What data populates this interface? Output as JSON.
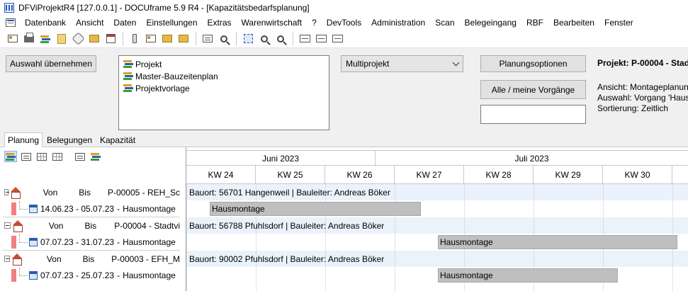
{
  "window": {
    "title": "DFViProjektR4 [127.0.0.1] - DOCUframe 5.9 R4 - [Kapazitätsbedarfsplanung]"
  },
  "menu": [
    "Datenbank",
    "Ansicht",
    "Daten",
    "Einstellungen",
    "Extras",
    "Warenwirtschaft",
    "?",
    "DevTools",
    "Administration",
    "Scan",
    "Belegeingang",
    "RBF",
    "Bearbeiten",
    "Fenster"
  ],
  "controls": {
    "auswahl_button": "Auswahl übernehmen",
    "list_items": [
      "Projekt",
      "Master-Bauzeitenplan",
      "Projektvorlage"
    ],
    "mode_select": "Multiprojekt",
    "planungsoptionen_button": "Planungsoptionen",
    "alle_button": "Alle / meine Vorgänge",
    "search_value": ""
  },
  "info": {
    "project": "Projekt: P-00004 - Stad",
    "ansicht": "Ansicht: Montageplanun",
    "auswahl": "Auswahl: Vorgang 'Haus",
    "sortierung": "Sortierung: Zeitlich"
  },
  "tabs": [
    "Planung",
    "Belegungen",
    "Kapazität"
  ],
  "tree": {
    "von_label": "Von",
    "bis_label": "Bis",
    "projects": [
      {
        "name": "P-00005 - REH_Sc",
        "task_dates": "14.06.23 - 05.07.23",
        "task_name": "Hausmontage",
        "location": "Bauort: 56701 Hangenweil | Bauleiter: Andreas Böker",
        "bar_label": "Hausmontage"
      },
      {
        "name": "P-00004 - Stadtvi",
        "task_dates": "07.07.23 - 31.07.23",
        "task_name": "Hausmontage",
        "location": "Bauort: 56788 Pfuhlsdorf | Bauleiter: Andreas Böker",
        "bar_label": "Hausmontage"
      },
      {
        "name": "P-00003 - EFH_M",
        "task_dates": "07.07.23 - 25.07.23",
        "task_name": "Hausmontage",
        "location": "Bauort: 90002 Pfuhlsdorf | Bauleiter: Andreas Böker",
        "bar_label": "Hausmontage"
      }
    ]
  },
  "gantt": {
    "months": [
      "Juni 2023",
      "Juli 2023"
    ],
    "weeks": [
      "KW 24",
      "KW 25",
      "KW 26",
      "KW 27",
      "KW 28",
      "KW 29",
      "KW 30"
    ]
  },
  "colors": {
    "project_row_bg": "#eaf2fb",
    "bar_fill": "#bfbfbf",
    "status_marker": "#f08080"
  }
}
